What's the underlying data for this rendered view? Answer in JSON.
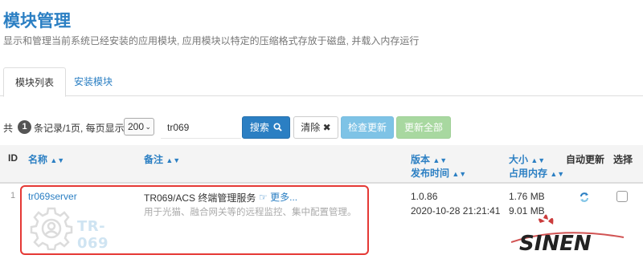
{
  "page": {
    "title": "模块管理",
    "description": "显示和管理当前系统已经安装的应用模块, 应用模块以特定的压缩格式存放于磁盘, 并载入内存运行"
  },
  "tabs": [
    {
      "label": "模块列表",
      "active": true
    },
    {
      "label": "安装模块",
      "active": false
    }
  ],
  "toolbar": {
    "prefix": "共",
    "count": "1",
    "summary": "条记录/1页, 每页显示",
    "page_size": "200",
    "search_value": "tr069",
    "search_label": "搜索",
    "clear_label": "清除",
    "check_update_label": "检查更新",
    "update_all_label": "更新全部"
  },
  "table": {
    "headers": {
      "id": "ID",
      "name": "名称",
      "remark": "备注",
      "version": "版本",
      "pubtime": "发布时间",
      "size": "大小",
      "memory": "占用内存",
      "auto_update": "自动更新",
      "select": "选择"
    },
    "rows": [
      {
        "num": "1",
        "name": "tr069server",
        "remark": "TR069/ACS 终端管理服务",
        "more": "更多...",
        "remark_detail": "用于光猫、融合网关等的远程监控、集中配置管理。",
        "version": "1.0.86",
        "pubtime": "2020-10-28 21:21:41",
        "size": "1.76 MB",
        "memory": "9.01 MB",
        "logo_text": "TR-069"
      }
    ]
  },
  "watermark": {
    "text": "SINEN"
  },
  "colors": {
    "primary": "#2b7fc3",
    "info": "#7ec3e6",
    "success": "#a8d8a0",
    "highlight": "#e53935"
  },
  "icons": {
    "search": "search-icon",
    "clear": "close-icon",
    "more": "hand-pointer-icon",
    "sort": "sort-icon",
    "auto_update": "refresh-icon"
  }
}
